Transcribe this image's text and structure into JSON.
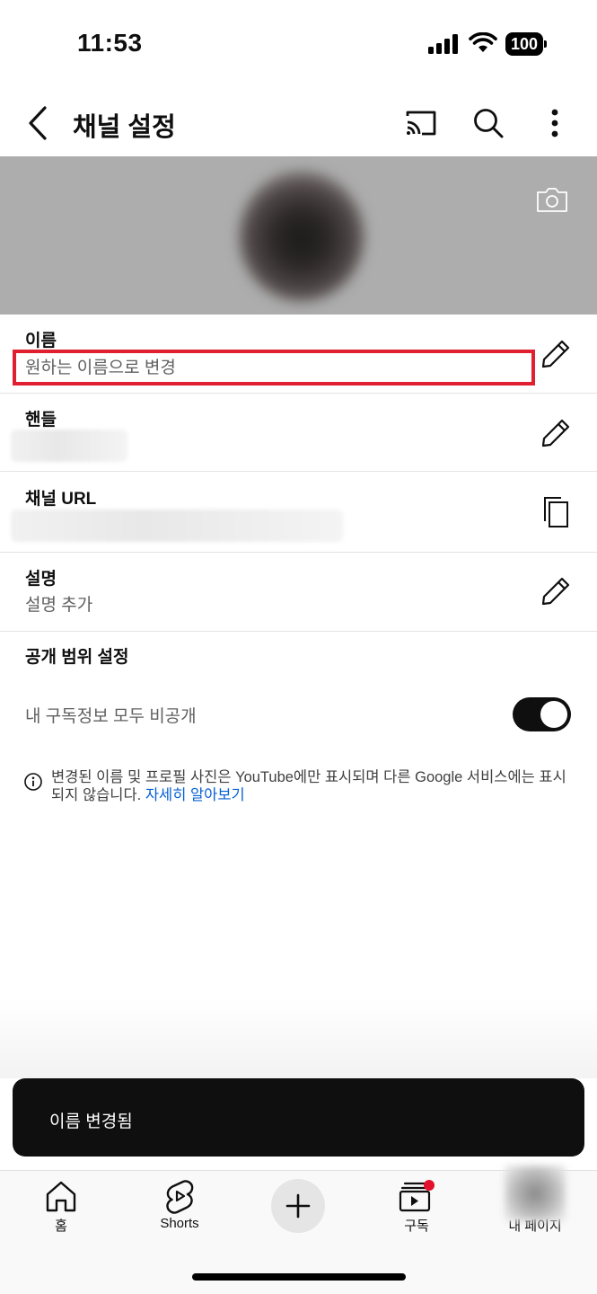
{
  "status_bar": {
    "time": "11:53",
    "battery": "100"
  },
  "header": {
    "title": "채널 설정"
  },
  "fields": {
    "name": {
      "label": "이름",
      "value": "원하는 이름으로 변경"
    },
    "handle": {
      "label": "핸들"
    },
    "channel_url": {
      "label": "채널 URL"
    },
    "description": {
      "label": "설명",
      "value": "설명 추가"
    }
  },
  "privacy": {
    "title": "공개 범위 설정",
    "subscriptions_private_label": "내 구독정보 모두 비공개",
    "subscriptions_private_on": true
  },
  "notice": {
    "text": "변경된 이름 및 프로필 사진은 YouTube에만 표시되며 다른 Google 서비스에는 표시되지 않습니다. ",
    "link": "자세히 알아보기"
  },
  "toast": {
    "message": "이름 변경됨"
  },
  "nav": {
    "home": "홈",
    "shorts": "Shorts",
    "subscriptions": "구독",
    "me": "내 페이지"
  },
  "colors": {
    "highlight": "#e02030",
    "link": "#065fd4",
    "badge": "#e3112b"
  }
}
